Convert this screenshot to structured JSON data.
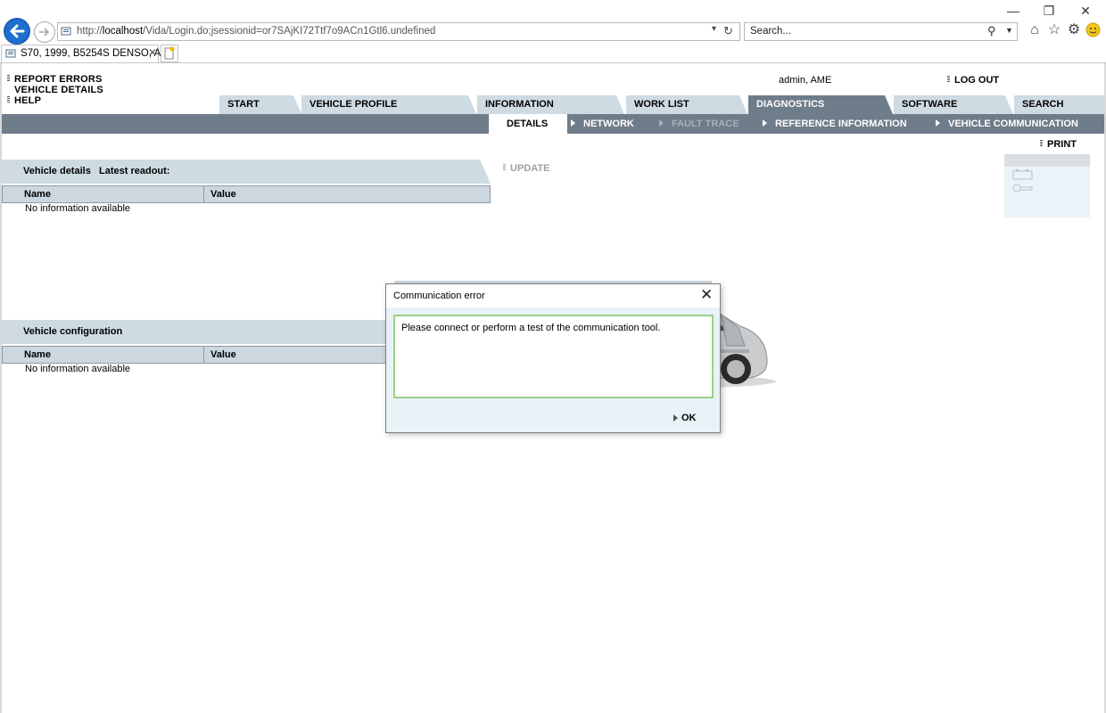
{
  "browser": {
    "url_prefix": "http://",
    "url_host": "localhost",
    "url_path": "/Vida/Login.do;jsessionid=or7SAjKI72Ttf7o9ACn1Gtl6.undefined",
    "search_placeholder": "Search...",
    "tab_title": "S70, 1999, B5254S DENSO, A...",
    "tab_close": "✕",
    "window_controls": [
      "—",
      "❐",
      "✕"
    ],
    "toolbar_icons": [
      "home-icon",
      "star-icon",
      "gear-icon",
      "smiley-icon"
    ]
  },
  "header": {
    "links": [
      "REPORT ERRORS",
      "VEHICLE DETAILS",
      "HELP"
    ],
    "user": "admin, AME",
    "logout": "LOG OUT"
  },
  "main_tabs": [
    {
      "label": "START",
      "active": false
    },
    {
      "label": "VEHICLE PROFILE",
      "active": false
    },
    {
      "label": "INFORMATION",
      "active": false
    },
    {
      "label": "WORK LIST",
      "active": false
    },
    {
      "label": "DIAGNOSTICS",
      "active": true
    },
    {
      "label": "SOFTWARE",
      "active": false
    },
    {
      "label": "SEARCH",
      "active": false
    }
  ],
  "sub_tabs": [
    {
      "label": "DETAILS",
      "state": "active"
    },
    {
      "label": "NETWORK",
      "state": "enabled"
    },
    {
      "label": "FAULT TRACE",
      "state": "disabled"
    },
    {
      "label": "REFERENCE INFORMATION",
      "state": "enabled"
    },
    {
      "label": "VEHICLE COMMUNICATION",
      "state": "enabled"
    }
  ],
  "actions": {
    "print": "PRINT",
    "update": "UPDATE"
  },
  "vehicle_details": {
    "title": "Vehicle details",
    "readout_label": "Latest readout:",
    "col_name": "Name",
    "col_value": "Value",
    "empty": "No information available"
  },
  "vehicle_configuration": {
    "title": "Vehicle configuration",
    "col_name": "Name",
    "col_value": "Value",
    "empty": "No information available"
  },
  "dialog": {
    "title": "Communication error",
    "close": "✕",
    "message": "Please connect or perform a test of the communication tool.",
    "ok": "OK"
  },
  "colors": {
    "tab_bg": "#cfdbe3",
    "tab_active": "#6f7c8a",
    "dialog_border_accent": "#9bd185"
  }
}
